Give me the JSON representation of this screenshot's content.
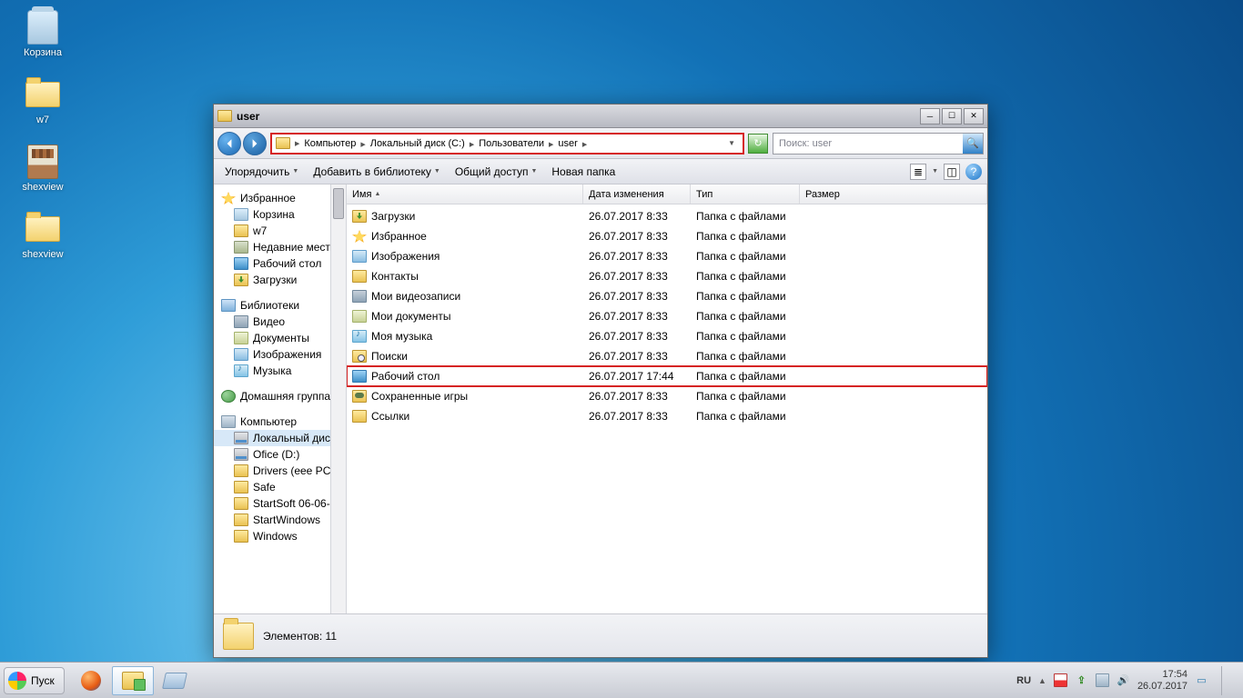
{
  "desktop_icons": [
    {
      "name": "recycle-bin",
      "label": "Корзина",
      "glyph": "bin"
    },
    {
      "name": "folder-w7",
      "label": "w7",
      "glyph": "folder"
    },
    {
      "name": "shexview",
      "label": "shexview",
      "glyph": "rar"
    },
    {
      "name": "folder-shexview",
      "label": "shexview",
      "glyph": "folder"
    }
  ],
  "window": {
    "title": "user",
    "breadcrumbs": [
      "Компьютер",
      "Локальный диск (C:)",
      "Пользователи",
      "user"
    ],
    "search_placeholder": "Поиск: user",
    "toolbar": {
      "arrange": "Упорядочить",
      "addlib": "Добавить в библиотеку",
      "share": "Общий доступ",
      "newfolder": "Новая папка"
    },
    "columns": {
      "name": "Имя",
      "date": "Дата изменения",
      "type": "Тип",
      "size": "Размер"
    },
    "rows": [
      {
        "icon": "dl",
        "name": "Загрузки",
        "date": "26.07.2017 8:33",
        "type": "Папка с файлами",
        "hl": false
      },
      {
        "icon": "star",
        "name": "Избранное",
        "date": "26.07.2017 8:33",
        "type": "Папка с файлами",
        "hl": false
      },
      {
        "icon": "img",
        "name": "Изображения",
        "date": "26.07.2017 8:33",
        "type": "Папка с файлами",
        "hl": false
      },
      {
        "icon": "fold",
        "name": "Контакты",
        "date": "26.07.2017 8:33",
        "type": "Папка с файлами",
        "hl": false
      },
      {
        "icon": "vid",
        "name": "Мои видеозаписи",
        "date": "26.07.2017 8:33",
        "type": "Папка с файлами",
        "hl": false
      },
      {
        "icon": "doc",
        "name": "Мои документы",
        "date": "26.07.2017 8:33",
        "type": "Папка с файлами",
        "hl": false
      },
      {
        "icon": "mus",
        "name": "Моя музыка",
        "date": "26.07.2017 8:33",
        "type": "Папка с файлами",
        "hl": false
      },
      {
        "icon": "search",
        "name": "Поиски",
        "date": "26.07.2017 8:33",
        "type": "Папка с файлами",
        "hl": false
      },
      {
        "icon": "desk",
        "name": "Рабочий стол",
        "date": "26.07.2017 17:44",
        "type": "Папка с файлами",
        "hl": true
      },
      {
        "icon": "game",
        "name": "Сохраненные игры",
        "date": "26.07.2017 8:33",
        "type": "Папка с файлами",
        "hl": false
      },
      {
        "icon": "link",
        "name": "Ссылки",
        "date": "26.07.2017 8:33",
        "type": "Папка с файлами",
        "hl": false
      }
    ],
    "status": "Элементов: 11",
    "navpane": {
      "favorites": {
        "label": "Избранное",
        "items": [
          {
            "icon": "bin",
            "label": "Корзина"
          },
          {
            "icon": "fold",
            "label": "w7"
          },
          {
            "icon": "recent",
            "label": "Недавние места"
          },
          {
            "icon": "desk",
            "label": "Рабочий стол"
          },
          {
            "icon": "dl",
            "label": "Загрузки"
          }
        ]
      },
      "libraries": {
        "label": "Библиотеки",
        "items": [
          {
            "icon": "vid",
            "label": "Видео"
          },
          {
            "icon": "doc",
            "label": "Документы"
          },
          {
            "icon": "img",
            "label": "Изображения"
          },
          {
            "icon": "mus",
            "label": "Музыка"
          }
        ]
      },
      "homegroup": {
        "label": "Домашняя группа"
      },
      "computer": {
        "label": "Компьютер",
        "items": [
          {
            "icon": "hdd",
            "label": "Локальный диск (",
            "sel": true
          },
          {
            "icon": "hdd",
            "label": "Ofice (D:)"
          },
          {
            "icon": "fold",
            "label": "Drivers (eee PC"
          },
          {
            "icon": "fold",
            "label": "Safe"
          },
          {
            "icon": "fold",
            "label": "StartSoft 06-06-"
          },
          {
            "icon": "fold",
            "label": "StartWindows"
          },
          {
            "icon": "fold",
            "label": "Windows"
          }
        ]
      }
    }
  },
  "taskbar": {
    "start": "Пуск",
    "lang": "RU",
    "time": "17:54",
    "date": "26.07.2017"
  }
}
